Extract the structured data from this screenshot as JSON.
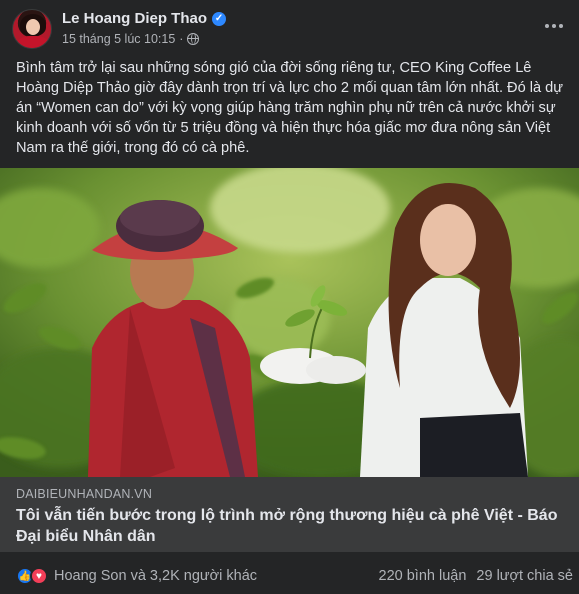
{
  "author": {
    "name": "Le Hoang Diep Thao",
    "verified": true,
    "timestamp": "15 tháng 5 lúc 10:15",
    "privacy_icon": "globe-icon"
  },
  "post_text": "Bình tâm trở lại sau những sóng gió của đời sống riêng tư, CEO King Coffee Lê Hoàng Diệp Thảo giờ đây dành trọn trí và lực cho 2 mối quan tâm lớn nhất. Đó là dự án “Women can do” với kỳ vọng giúp hàng trăm nghìn phụ nữ trên cả nước khởi sự kinh doanh với số vốn từ 5 triệu đồng và hiện thực hóa giấc mơ đưa nông sản Việt Nam ra thế giới, trong đó có cà phê.",
  "link_preview": {
    "domain": "DAIBIEUNHANDAN.VN",
    "title": "Tôi vẫn tiến bước trong lộ trình mở rộng thương hiệu cà phê Việt - Báo Đại biểu Nhân dân"
  },
  "reactions": {
    "icons": [
      "like-icon",
      "love-icon"
    ],
    "summary": "Hoang Son và 3,2K người khác"
  },
  "counts": {
    "comments": "220 bình luận",
    "shares": "29 lượt chia sẻ"
  },
  "colors": {
    "background": "#242526",
    "text_primary": "#e4e6eb",
    "text_secondary": "#b0b3b8",
    "like_blue": "#1877f2",
    "love_red": "#f33e58",
    "verified_blue": "#2d88ff"
  }
}
